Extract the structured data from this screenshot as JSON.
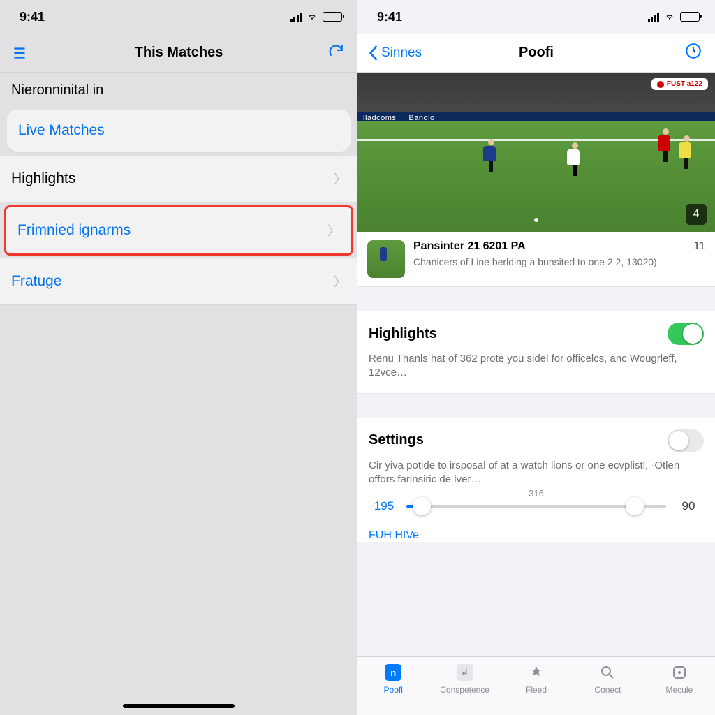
{
  "left": {
    "status_time": "9:41",
    "nav_title": "This Matches",
    "header_text": "Nieronninital in",
    "items": [
      {
        "label": "Live Matches"
      },
      {
        "label": "Highlights"
      },
      {
        "label": "Frimnied ignarms"
      },
      {
        "label": "Fratuge"
      }
    ]
  },
  "right": {
    "status_time": "9:41",
    "back_label": "Sinnes",
    "nav_title": "Poofi",
    "hero_badge": "FUST a122",
    "hero_counter": "4",
    "adboard_text": "lladcoms",
    "feed": {
      "title": "Pansinter 21 6201 PA",
      "subtitle": "Chanicers of Line berlding a bunsited to one 2 2, 13020)",
      "count": "11"
    },
    "sections": [
      {
        "title": "Highlights",
        "desc": "Renu Thanls hat of 362 prote you sidel for officelcs, anc Wougrleff, 12vce…",
        "toggle": true
      },
      {
        "title": "Settings",
        "desc": "Cir yiva potide to irsposal of at a watch lions or one ecvplistl, ·Otlen offors farinsiric de lver…",
        "toggle": false
      }
    ],
    "slider": {
      "left": "195",
      "mid": "316",
      "right": "90"
    },
    "bottom_link": "FUH HIVe",
    "tabs": [
      {
        "label": "Poofl"
      },
      {
        "label": "Conspetence"
      },
      {
        "label": "Fleed"
      },
      {
        "label": "Conect"
      },
      {
        "label": "Mecule"
      }
    ]
  }
}
